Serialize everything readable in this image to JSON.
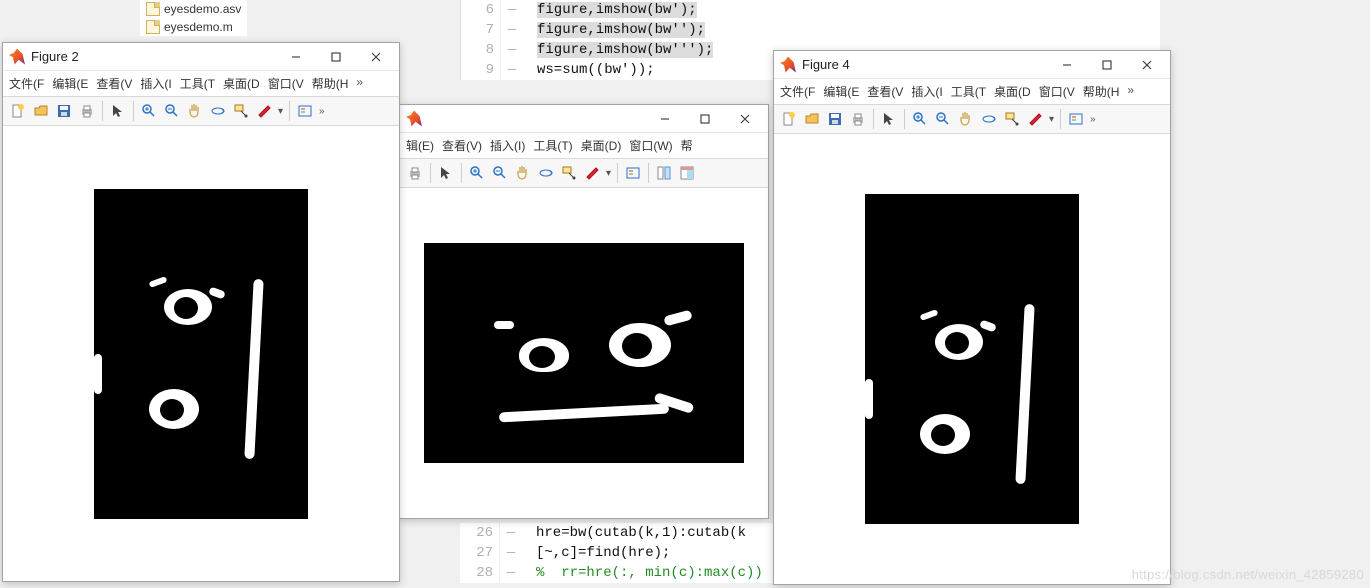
{
  "files": [
    "eyesdemo.asv",
    "eyesdemo.m"
  ],
  "editor_top": [
    {
      "n": "6",
      "code": "figure,imshow(bw');",
      "hl": true
    },
    {
      "n": "7",
      "code": "figure,imshow(bw'');",
      "hl": true
    },
    {
      "n": "8",
      "code": "figure,imshow(bw''');",
      "hl": true
    },
    {
      "n": "9",
      "code": "ws=sum((bw'));",
      "hl": false
    }
  ],
  "editor_bottom": [
    {
      "n": "26",
      "code": "hre=bw(cutab(k,1):cutab(k",
      "hl": false
    },
    {
      "n": "27",
      "code": "[~,c]=find(hre);",
      "hl": false
    },
    {
      "n": "28",
      "code": "%  rr=hre(:, min(c):max(c))",
      "hl": false,
      "comment": true
    }
  ],
  "figwins": {
    "fig2": {
      "title": "Figure 2"
    },
    "fig3": {
      "title": ""
    },
    "fig4": {
      "title": "Figure 4"
    }
  },
  "menu_full": [
    "文件(F",
    "编辑(E",
    "查看(V",
    "插入(I",
    "工具(T",
    "桌面(D",
    "窗口(V",
    "帮助(H"
  ],
  "menu_partial": [
    "辑(E)",
    "查看(V)",
    "插入(I)",
    "工具(T)",
    "桌面(D)",
    "窗口(W)",
    "帮"
  ],
  "icons": {
    "new": "new-file-icon",
    "open": "open-folder-icon",
    "save": "save-icon",
    "print": "print-icon",
    "pointer": "pointer-icon",
    "zoomin": "zoom-in-icon",
    "zoomout": "zoom-out-icon",
    "pan": "pan-icon",
    "rotate": "rotate3d-icon",
    "datacursor": "data-cursor-icon",
    "brush": "brush-icon",
    "link": "colorbar-icon",
    "insert": "insert-legend-icon",
    "dock": "dock-icon",
    "extra1": "layout-icon",
    "extra2": "panel-icon"
  },
  "watermark": "https://blog.csdn.net/weixin_42859280"
}
